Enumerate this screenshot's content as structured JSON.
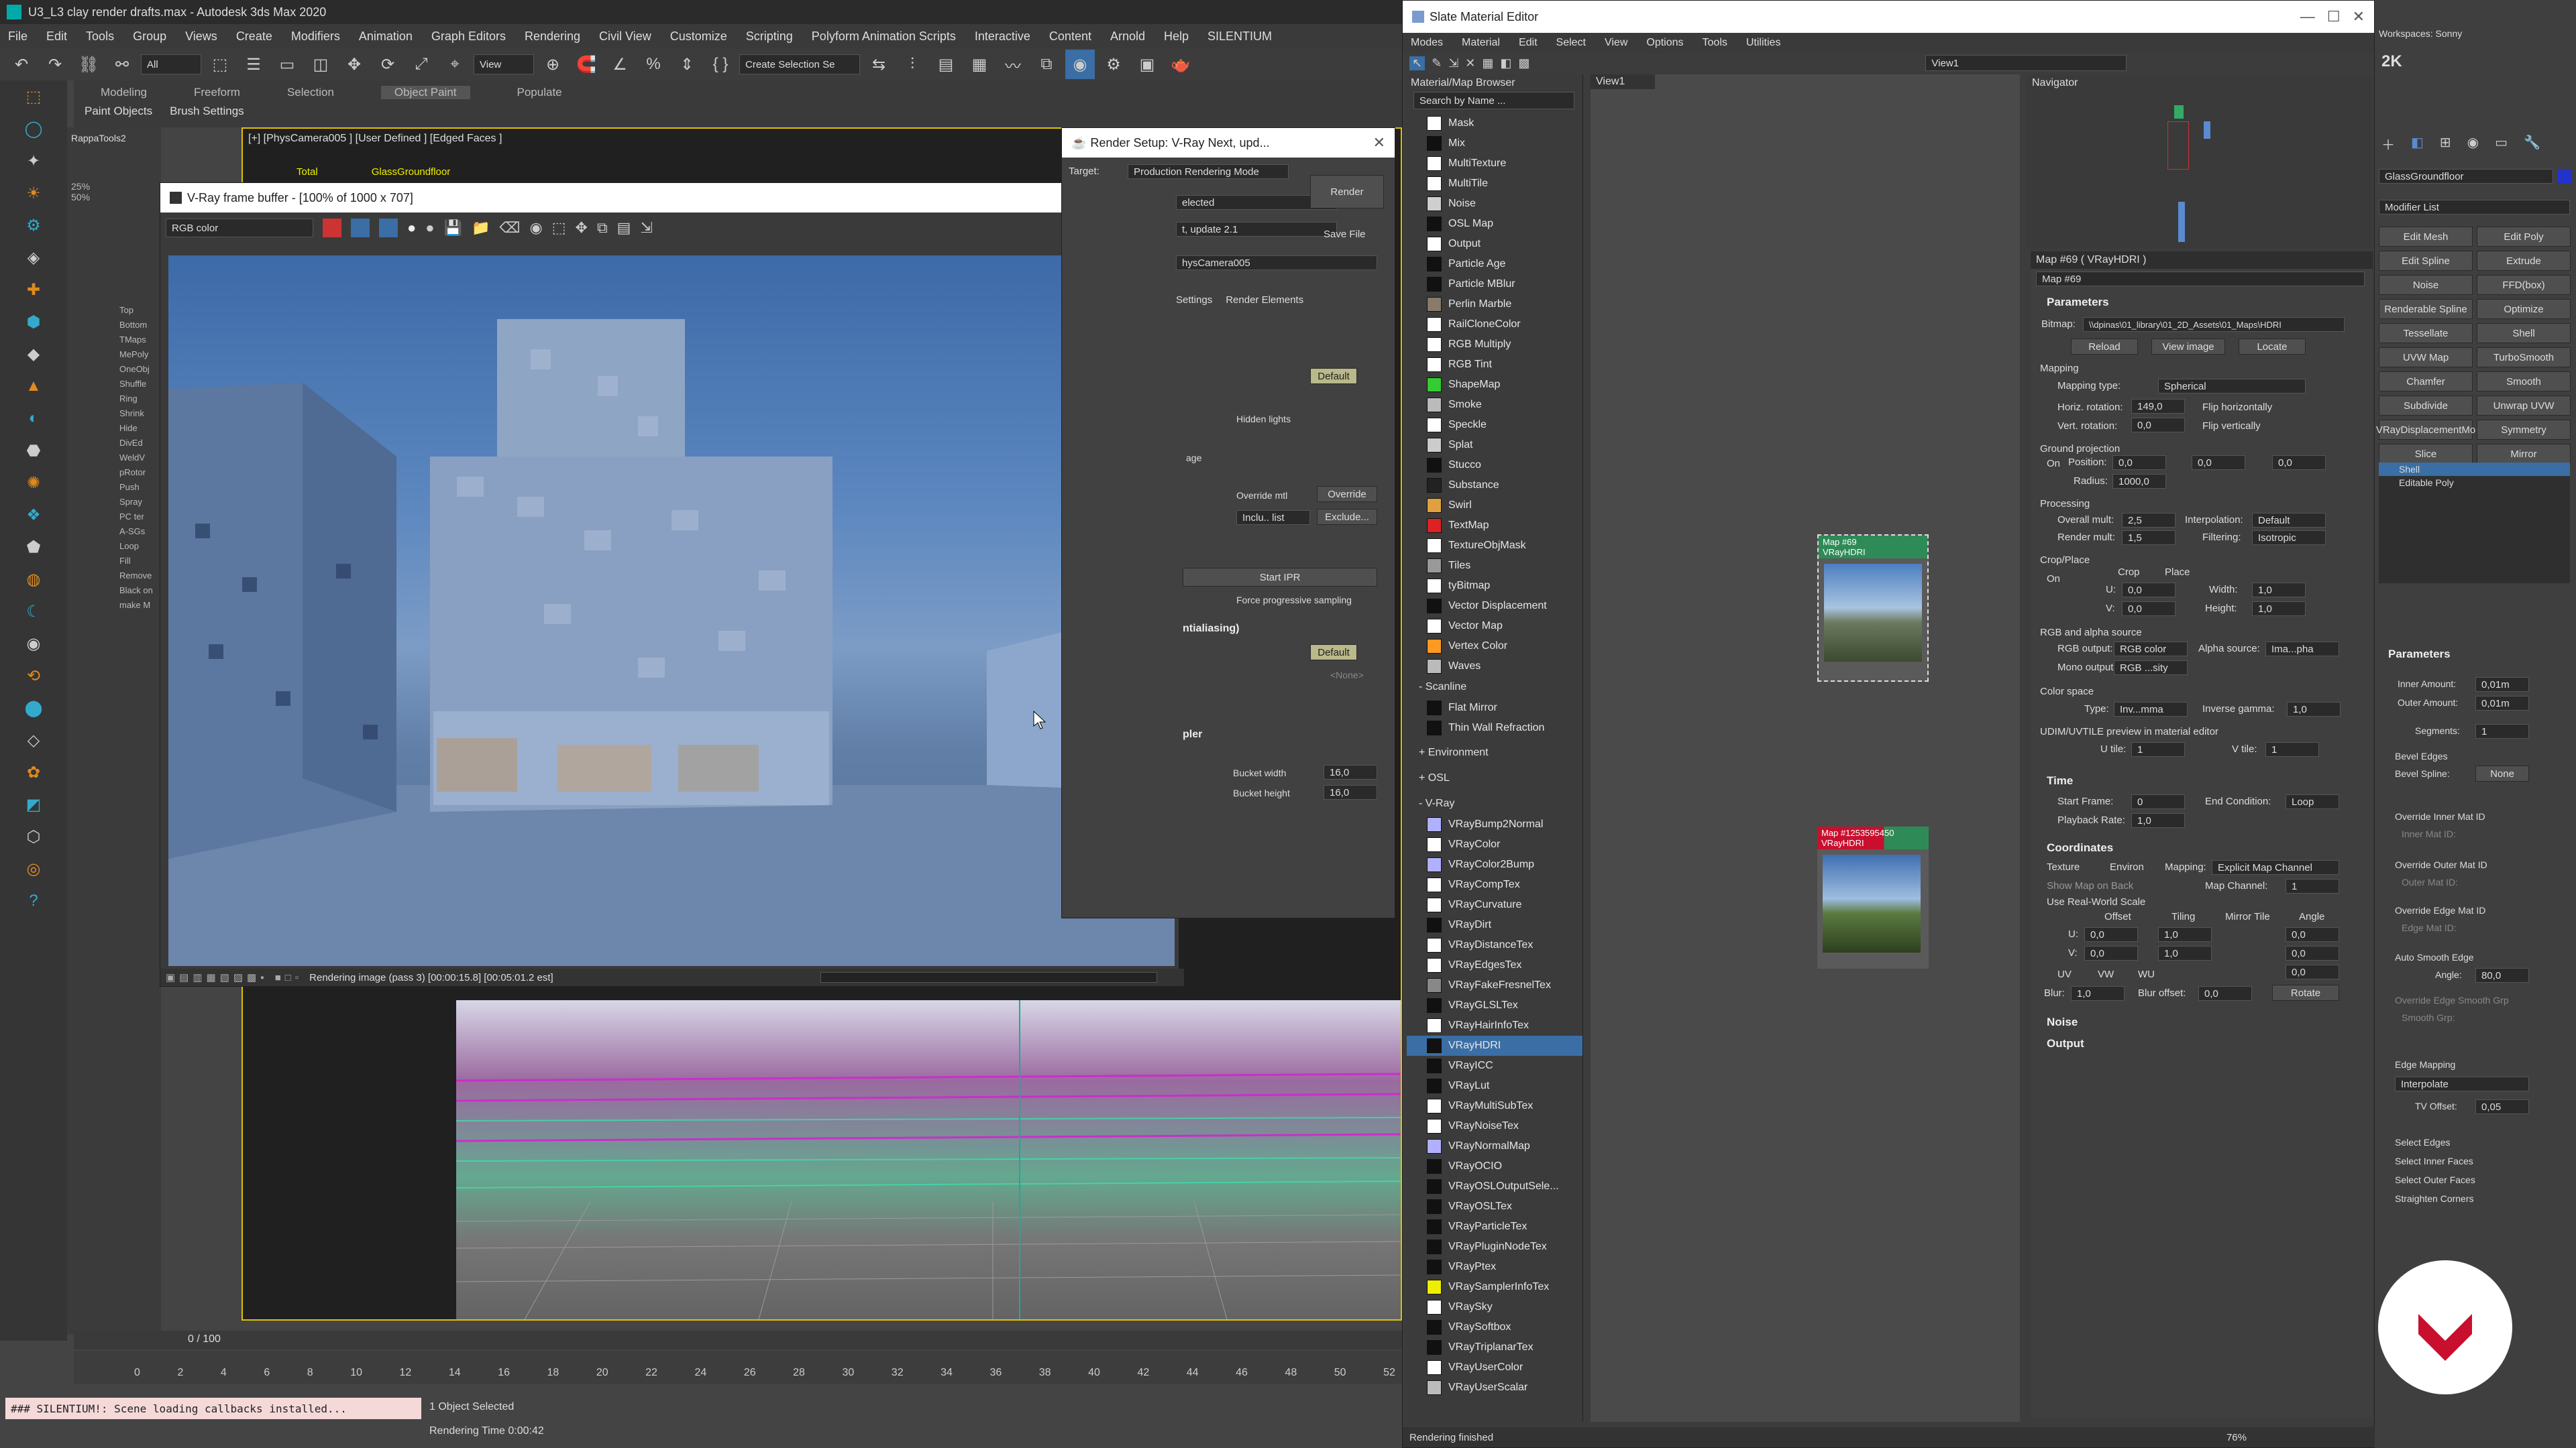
{
  "app": {
    "title": "U3_L3 clay render drafts.max - Autodesk 3ds Max 2020",
    "menu": [
      "File",
      "Edit",
      "Tools",
      "Group",
      "Views",
      "Create",
      "Modifiers",
      "Animation",
      "Graph Editors",
      "Rendering",
      "Civil View",
      "Customize",
      "Scripting",
      "Polyform Animation Scripts",
      "Interactive",
      "Content",
      "Arnold",
      "Help",
      "SILENTIUM"
    ],
    "workspace_label": "Workspaces: Sonny",
    "ribbon_tabs": [
      "Modeling",
      "Freeform",
      "Selection",
      "Object Paint",
      "Populate"
    ],
    "ribbon_sub": [
      "Paint Objects",
      "Brush Settings"
    ],
    "selection_filter": "All",
    "view_dropdown": "View",
    "selection_set": "Create Selection Se",
    "k_label": "2K",
    "viewport_label": "[+] [PhysCamera005 ] [User Defined ] [Edged Faces ]",
    "viewport_stats": [
      "Total",
      "GlassGroundfloor"
    ],
    "rappa_label": "RappaTools2",
    "left_tool_labels": [
      "Top",
      "Bottom",
      "TMaps",
      "MePoly",
      "OneObj",
      "Shuffle",
      "Ring",
      "Shrink",
      "Hide",
      "DivEd",
      "WeldV",
      "pRotor",
      "Push",
      "Spray",
      "PC ter",
      "A-SGs",
      "Loop",
      "Fill",
      "Remove",
      "Black on",
      "make M"
    ],
    "percents": [
      "25%",
      "50%"
    ]
  },
  "timeline": {
    "counter": "0 / 100",
    "ticks": [
      "0",
      "2",
      "4",
      "6",
      "8",
      "10",
      "12",
      "14",
      "16",
      "18",
      "20",
      "22",
      "24",
      "26",
      "28",
      "30",
      "32",
      "34",
      "36",
      "38",
      "40",
      "42",
      "44",
      "46",
      "48",
      "50",
      "52"
    ]
  },
  "status": {
    "script_line": "### SILENTIUM!: Scene loading callbacks installed...",
    "selected": "1 Object Selected",
    "render_time": "Rendering Time 0:00:42"
  },
  "vfb": {
    "title": "V-Ray frame buffer - [100% of 1000 x 707]",
    "channel": "RGB color",
    "progress_text": "Rendering image (pass 3) [00:00:15.8] [00:05:01.2 est]"
  },
  "render_setup": {
    "title": "Render Setup: V-Ray Next, upd...",
    "target_label": "Target:",
    "target_value": "Production Rendering Mode",
    "preset_value": "elected",
    "renderer_value": "t, update 2.1",
    "view_value": "hysCamera005",
    "render_button": "Render",
    "save_file": "Save File",
    "tabs": [
      "Settings",
      "Render Elements"
    ],
    "default1": "Default",
    "hidden_lights": "Hidden lights",
    "age": "age",
    "override_mtl": "Override mtl",
    "override_btn": "Override",
    "inclu_list": "Inclu.. list",
    "exclude": "Exclude...",
    "start_ipr": "Start IPR",
    "force_prog": "Force progressive sampling",
    "antialiasing": "ntialiasing)",
    "default2": "Default",
    "none": "<None>",
    "sampler": "pler",
    "bucket_width_label": "Bucket width",
    "bucket_width": "16,0",
    "bucket_height_label": "Bucket height",
    "bucket_height": "16,0"
  },
  "sme": {
    "title": "Slate Material Editor",
    "menu": [
      "Modes",
      "Material",
      "Edit",
      "Select",
      "View",
      "Options",
      "Tools",
      "Utilities"
    ],
    "browser_title": "Material/Map Browser",
    "search_placeholder": "Search by Name ...",
    "view_tab": "View1",
    "view_dropdown": "View1",
    "maps_general": [
      {
        "name": "Mask",
        "color": "#ffffff"
      },
      {
        "name": "Mix",
        "color": "#111111"
      },
      {
        "name": "MultiTexture",
        "color": "#ffffff"
      },
      {
        "name": "MultiTile",
        "color": "#ffffff"
      },
      {
        "name": "Noise",
        "color": "#cfcfcf"
      },
      {
        "name": "OSL Map",
        "color": "#111111"
      },
      {
        "name": "Output",
        "color": "#ffffff"
      },
      {
        "name": "Particle Age",
        "color": "#111111"
      },
      {
        "name": "Particle MBlur",
        "color": "#111111"
      },
      {
        "name": "Perlin Marble",
        "color": "#8a7a6a"
      },
      {
        "name": "RailCloneColor",
        "color": "#ffffff"
      },
      {
        "name": "RGB Multiply",
        "color": "#ffffff"
      },
      {
        "name": "RGB Tint",
        "color": "#ffffff"
      },
      {
        "name": "ShapeMap",
        "color": "#33cc33"
      },
      {
        "name": "Smoke",
        "color": "#bbbbbb"
      },
      {
        "name": "Speckle",
        "color": "#ffffff"
      },
      {
        "name": "Splat",
        "color": "#cccccc"
      },
      {
        "name": "Stucco",
        "color": "#111111"
      },
      {
        "name": "Substance",
        "color": "#222222"
      },
      {
        "name": "Swirl",
        "color": "#e0a040"
      },
      {
        "name": "TextMap",
        "color": "#dd2222"
      },
      {
        "name": "TextureObjMask",
        "color": "#ffffff"
      },
      {
        "name": "Tiles",
        "color": "#999999"
      },
      {
        "name": "tyBitmap",
        "color": "#ffffff"
      },
      {
        "name": "Vector Displacement",
        "color": "#111111"
      },
      {
        "name": "Vector Map",
        "color": "#ffffff"
      },
      {
        "name": "Vertex Color",
        "color": "#ff9922"
      },
      {
        "name": "Waves",
        "color": "#bbbbbb"
      }
    ],
    "scanline_header": "- Scanline",
    "maps_scanline": [
      {
        "name": "Flat Mirror",
        "color": "#111111"
      },
      {
        "name": "Thin Wall Refraction",
        "color": "#111111"
      }
    ],
    "environment_header": "+ Environment",
    "osl_header": "+ OSL",
    "vray_header": "- V-Ray",
    "maps_vray": [
      {
        "name": "VRayBump2Normal",
        "color": "#b0b0ff"
      },
      {
        "name": "VRayColor",
        "color": "#ffffff"
      },
      {
        "name": "VRayColor2Bump",
        "color": "#b0b0ff"
      },
      {
        "name": "VRayCompTex",
        "color": "#ffffff"
      },
      {
        "name": "VRayCurvature",
        "color": "#ffffff"
      },
      {
        "name": "VRayDirt",
        "color": "#111111"
      },
      {
        "name": "VRayDistanceTex",
        "color": "#ffffff"
      },
      {
        "name": "VRayEdgesTex",
        "color": "#ffffff"
      },
      {
        "name": "VRayFakeFresnelTex",
        "color": "#888888"
      },
      {
        "name": "VRayGLSLTex",
        "color": "#111111"
      },
      {
        "name": "VRayHairInfoTex",
        "color": "#ffffff"
      },
      {
        "name": "VRayHDRI",
        "color": "#111111"
      },
      {
        "name": "VRayICC",
        "color": "#111111"
      },
      {
        "name": "VRayLut",
        "color": "#111111"
      },
      {
        "name": "VRayMultiSubTex",
        "color": "#ffffff"
      },
      {
        "name": "VRayNoiseTex",
        "color": "#ffffff"
      },
      {
        "name": "VRayNormalMap",
        "color": "#b0b0ff"
      },
      {
        "name": "VRayOCIO",
        "color": "#111111"
      },
      {
        "name": "VRayOSLOutputSele...",
        "color": "#111111"
      },
      {
        "name": "VRayOSLTex",
        "color": "#111111"
      },
      {
        "name": "VRayParticleTex",
        "color": "#111111"
      },
      {
        "name": "VRayPluginNodeTex",
        "color": "#111111"
      },
      {
        "name": "VRayPtex",
        "color": "#111111"
      },
      {
        "name": "VRaySamplerInfoTex",
        "color": "#eeee00"
      },
      {
        "name": "VRaySky",
        "color": "#ffffff"
      },
      {
        "name": "VRaySoftbox",
        "color": "#111111"
      },
      {
        "name": "VRayTriplanarTex",
        "color": "#111111"
      },
      {
        "name": "VRayUserColor",
        "color": "#ffffff"
      },
      {
        "name": "VRayUserScalar",
        "color": "#bbbbbb"
      }
    ],
    "node1_title": "Map #69",
    "node1_sub": "VRayHDRI",
    "node2_title": "Map #1253595450",
    "node2_sub": "VRayHDRI",
    "navigator": "Navigator",
    "status_left": "Rendering finished",
    "zoom": "76%"
  },
  "params": {
    "map_header": "Map #69  ( VRayHDRI )",
    "map_name": "Map #69",
    "parameters": "Parameters",
    "bitmap_label": "Bitmap:",
    "bitmap_path": "\\\\dpinas\\01_library\\01_2D_Assets\\01_Maps\\HDRI",
    "reload": "Reload",
    "view_image": "View image",
    "locate": "Locate",
    "mapping": "Mapping",
    "mapping_type_label": "Mapping type:",
    "mapping_type": "Spherical",
    "horiz_rot_label": "Horiz. rotation:",
    "horiz_rot": "149,0",
    "flip_h": "Flip horizontally",
    "vert_rot_label": "Vert. rotation:",
    "vert_rot": "0,0",
    "flip_v": "Flip vertically",
    "ground_proj": "Ground projection",
    "on": "On",
    "position": "Position:",
    "pos_vals": [
      "0,0",
      "0,0",
      "0,0"
    ],
    "radius_label": "Radius:",
    "radius": "1000,0",
    "processing": "Processing",
    "overall_mult_label": "Overall mult:",
    "overall_mult": "2,5",
    "interp_label": "Interpolation:",
    "interp": "Default",
    "render_mult_label": "Render mult:",
    "render_mult": "1,5",
    "filtering_label": "Filtering:",
    "filtering": "Isotropic",
    "crop_place": "Crop/Place",
    "crop": "Crop",
    "place": "Place",
    "u_label": "U:",
    "v_label": "V:",
    "width_label": "Width:",
    "height_label": "Height:",
    "crop_u": "0,0",
    "crop_v": "0,0",
    "crop_w": "1,0",
    "crop_h": "1,0",
    "rgb_alpha": "RGB and alpha source",
    "rgb_output_label": "RGB output:",
    "rgb_output": "RGB color",
    "alpha_src_label": "Alpha source:",
    "alpha_src": "Ima...pha",
    "mono_label": "Mono output:",
    "mono": "RGB ...sity",
    "color_space": "Color space",
    "type_label": "Type:",
    "type": "Inv...mma",
    "inv_gamma_label": "Inverse gamma:",
    "inv_gamma": "1,0",
    "udim": "UDIM/UVTILE preview in material editor",
    "u_tile_label": "U tile:",
    "u_tile": "1",
    "v_tile_label": "V tile:",
    "v_tile": "1",
    "time": "Time",
    "start_frame_label": "Start Frame:",
    "start_frame": "0",
    "end_cond_label": "End Condition:",
    "end_cond": "Loop",
    "playback_label": "Playback Rate:",
    "playback": "1,0",
    "coordinates": "Coordinates",
    "texture": "Texture",
    "environ": "Environ",
    "mapping2_label": "Mapping:",
    "mapping2": "Explicit Map Channel",
    "show_map": "Show Map on Back",
    "map_channel_label": "Map Channel:",
    "map_channel": "1",
    "real_world": "Use Real-World Scale",
    "offset": "Offset",
    "tiling": "Tiling",
    "mirror_tile": "Mirror Tile",
    "angle": "Angle",
    "u_off": "0,0",
    "v_off": "0,0",
    "u_til": "1,0",
    "v_til": "1,0",
    "u_ang": "0,0",
    "v_ang": "0,0",
    "w_ang": "0,0",
    "uv": "UV",
    "vw": "VW",
    "wu": "WU",
    "blur_label": "Blur:",
    "blur": "1,0",
    "blur_off_label": "Blur offset:",
    "blur_off": "0,0",
    "rotate": "Rotate",
    "noise": "Noise",
    "output": "Output"
  },
  "modify": {
    "object_name": "GlassGroundfloor",
    "modifier_list": "Modifier List",
    "buttons": [
      [
        "Edit Mesh",
        "Edit Poly"
      ],
      [
        "Edit Spline",
        "Extrude"
      ],
      [
        "Noise",
        "FFD(box)"
      ],
      [
        "Renderable Spline",
        "Optimize"
      ],
      [
        "Tessellate",
        "Shell"
      ],
      [
        "UVW Map",
        "TurboSmooth"
      ],
      [
        "Chamfer",
        "Smooth"
      ],
      [
        "Subdivide",
        "Unwrap UVW"
      ],
      [
        "VRayDisplacementMo",
        "Symmetry"
      ],
      [
        "Slice",
        "Mirror"
      ]
    ],
    "stack": [
      "Shell",
      "Editable Poly"
    ],
    "parameters": "Parameters",
    "inner_label": "Inner Amount:",
    "inner": "0,01m",
    "outer_label": "Outer Amount:",
    "outer": "0,01m",
    "segments_label": "Segments:",
    "segments": "1",
    "bevel_edges": "Bevel Edges",
    "bevel_spline_label": "Bevel Spline:",
    "bevel_spline": "None",
    "override_inner": "Override Inner Mat ID",
    "inner_mat": "Inner Mat ID:",
    "override_outer": "Override Outer Mat ID",
    "outer_mat": "Outer Mat ID:",
    "override_edge": "Override Edge Mat ID",
    "edge_mat": "Edge Mat ID:",
    "auto_smooth": "Auto Smooth Edge",
    "angle_label": "Angle:",
    "angle": "80,0",
    "override_smooth": "Override Edge Smooth Grp",
    "smooth_grp": "Smooth Grp:",
    "edge_mapping": "Edge Mapping",
    "edge_mapping_val": "Interpolate",
    "tv_offset_label": "TV Offset:",
    "tv_offset": "0,05",
    "select_edges": "Select Edges",
    "select_inner": "Select Inner Faces",
    "select_outer": "Select Outer Faces",
    "straighten": "Straighten Corners"
  },
  "colors": {
    "accent_blue": "#3a6ea5",
    "sme_red": "#c8102e",
    "node_green": "#2e8b57"
  }
}
